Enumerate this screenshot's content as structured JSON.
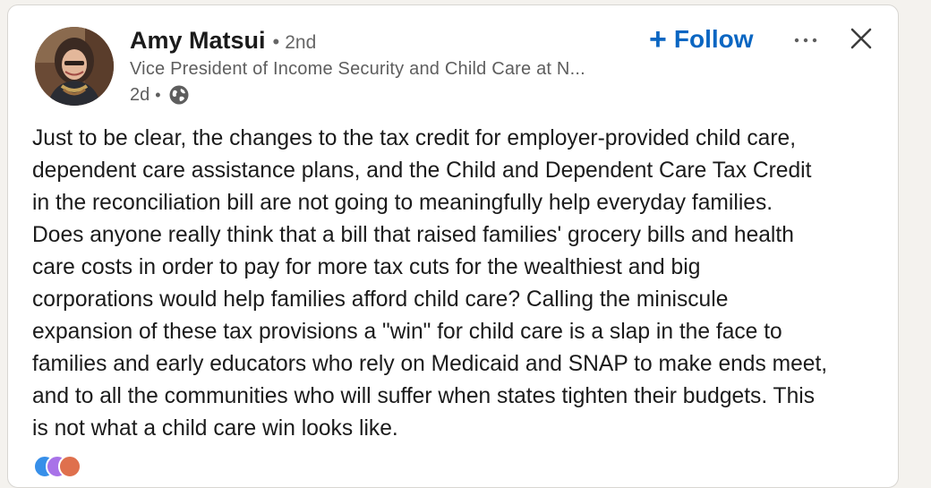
{
  "post": {
    "author_name": "Amy Matsui",
    "separator": "•",
    "connection_degree": "2nd",
    "headline": "Vice President of Income Security and Child Care at N...",
    "time_ago": "2d",
    "meta_separator": "•",
    "visibility_icon": "globe-icon",
    "follow_label": "Follow",
    "follow_prefix": "+",
    "more_icon": "more-icon",
    "close_icon": "close-icon",
    "body_lines": [
      "Just to be clear, the changes to the tax credit for employer-provided child care,",
      "dependent care assistance plans, and the Child and Dependent Care Tax Credit",
      "in the reconciliation bill are not going to meaningfully help everyday families.",
      "Does anyone really think that a bill that raised families' grocery bills and health",
      "care costs in order to pay for more tax cuts for the wealthiest and big",
      "corporations would help families afford child care? Calling the miniscule",
      "expansion of these tax provisions a \"win\" for child care is a slap in the face to",
      "families and early educators who rely on Medicaid and SNAP to make ends meet,",
      "and to all the communities who will suffer when states tighten their budgets. This",
      "is not what a child care win looks like."
    ]
  },
  "colors": {
    "accent": "#0a66c2",
    "text_primary": "#1b1b1b",
    "text_secondary": "#5e5e5e",
    "card_bg": "#ffffff",
    "page_bg": "#f4f2ee"
  },
  "reactions": [
    "like-reaction-icon",
    "support-reaction-icon",
    "love-reaction-icon"
  ]
}
